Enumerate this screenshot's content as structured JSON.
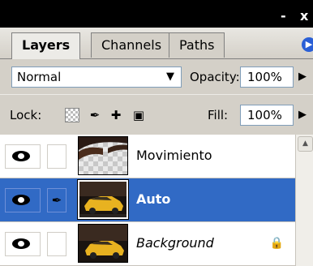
{
  "window": {
    "minimize_label": "-",
    "close_label": "x"
  },
  "tabs": [
    {
      "label": "Layers",
      "active": true
    },
    {
      "label": "Channels",
      "active": false
    },
    {
      "label": "Paths",
      "active": false
    }
  ],
  "blend": {
    "mode": "Normal"
  },
  "opacity": {
    "label": "Opacity:",
    "value": "100%"
  },
  "lock": {
    "label": "Lock:",
    "icons": [
      "lock-transparent-icon",
      "lock-brush-icon",
      "lock-move-icon",
      "lock-all-icon"
    ]
  },
  "fill": {
    "label": "Fill:",
    "value": "100%"
  },
  "layers": [
    {
      "name": "Movimiento",
      "selected": false,
      "linked": false,
      "locked": false
    },
    {
      "name": "Auto",
      "selected": true,
      "linked": true,
      "locked": false
    },
    {
      "name": "Background",
      "selected": false,
      "linked": false,
      "locked": true
    }
  ],
  "colors": {
    "selection": "#316ac5",
    "panel": "#d4d0c8",
    "titlebar": "#000000"
  }
}
